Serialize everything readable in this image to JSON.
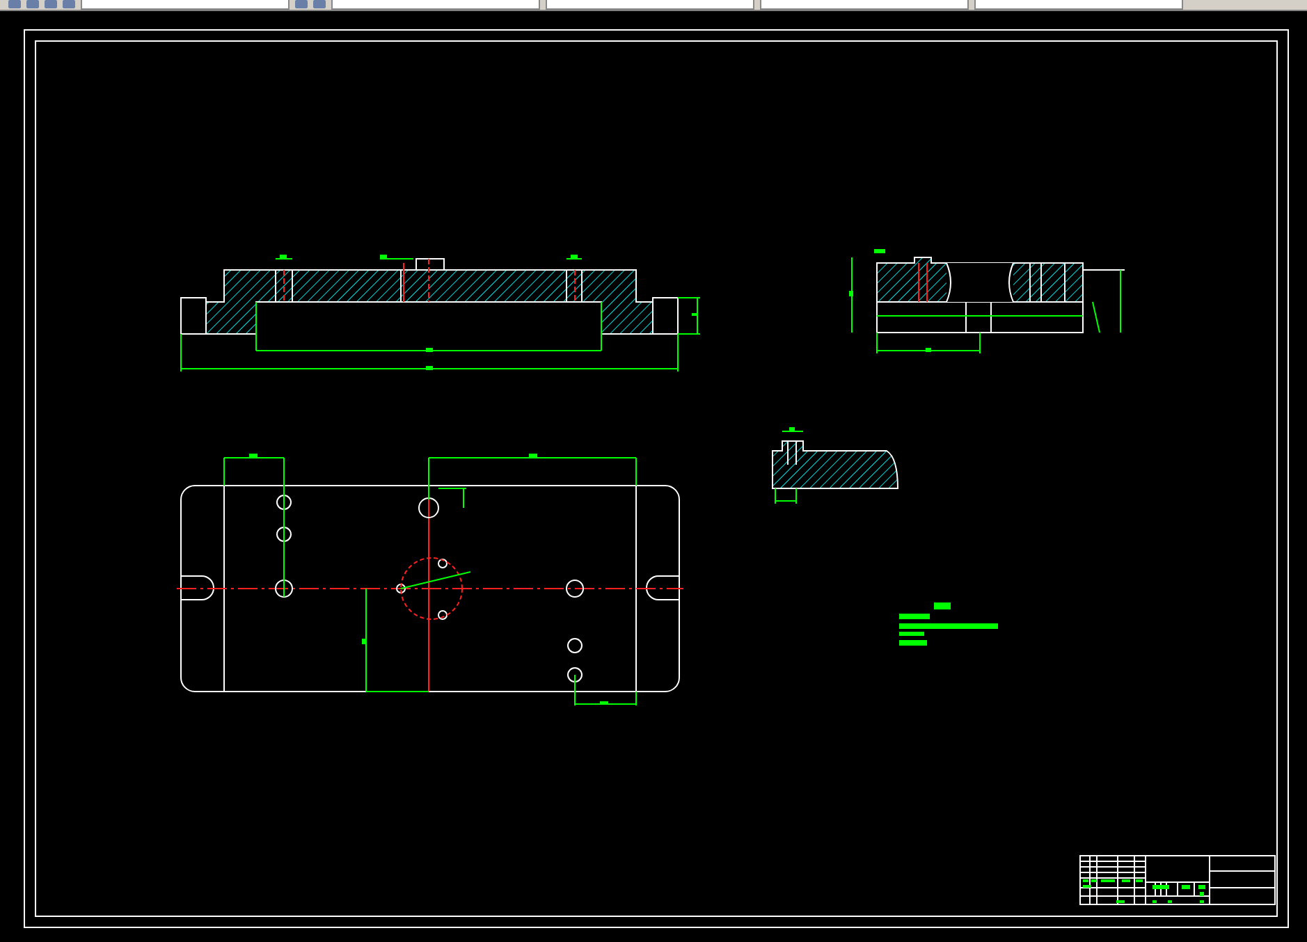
{
  "toolbar": {
    "items": [
      {
        "kind": "icon"
      },
      {
        "kind": "icon"
      },
      {
        "kind": "icon"
      },
      {
        "kind": "icon"
      },
      {
        "kind": "dropdown"
      },
      {
        "kind": "icon"
      },
      {
        "kind": "icon"
      },
      {
        "kind": "dropdown"
      },
      {
        "kind": "dropdown"
      },
      {
        "kind": "dropdown"
      },
      {
        "kind": "dropdown"
      }
    ]
  },
  "drawing_sheet": {
    "views": [
      {
        "kind": "front-section"
      },
      {
        "kind": "side-section"
      },
      {
        "kind": "detail-section"
      },
      {
        "kind": "top-view"
      }
    ],
    "notes": {
      "kind": "technical-requirements"
    },
    "title_block": {
      "kind": "standard"
    }
  }
}
